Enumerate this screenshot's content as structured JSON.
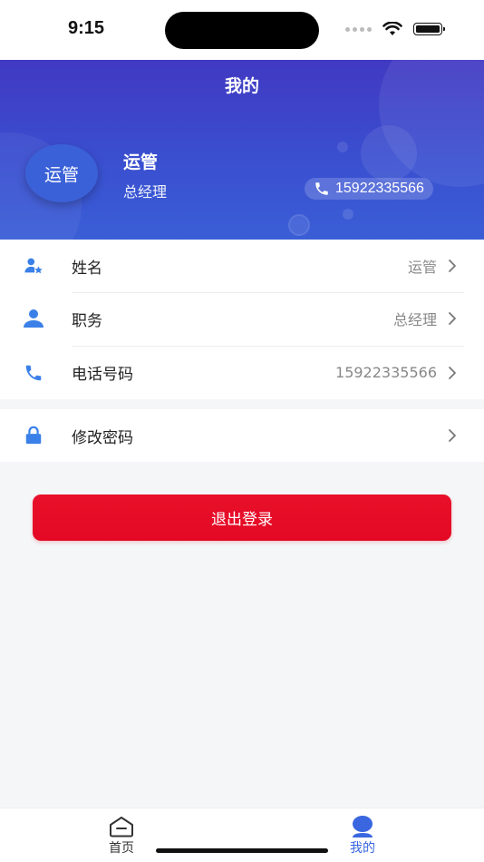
{
  "status_bar": {
    "time": "9:15"
  },
  "header": {
    "title": "我的",
    "avatar_text": "运管",
    "user_name": "运管",
    "user_role": "总经理",
    "phone": "15922335566"
  },
  "profile_items": [
    {
      "label": "姓名",
      "value": "运管",
      "icon": "user-tag-icon"
    },
    {
      "label": "职务",
      "value": "总经理",
      "icon": "user-icon"
    },
    {
      "label": "电话号码",
      "value": "15922335566",
      "icon": "phone-icon"
    }
  ],
  "security_items": [
    {
      "label": "修改密码",
      "icon": "lock-icon"
    }
  ],
  "logout_label": "退出登录",
  "tab_bar": {
    "tabs": [
      {
        "label": "首页",
        "icon": "home-icon",
        "active": false
      },
      {
        "label": "我的",
        "icon": "profile-icon",
        "active": true
      }
    ]
  },
  "colors": {
    "header_gradient_start": "#4139c2",
    "header_gradient_end": "#3a5ed6",
    "icon_blue": "#3a80e8",
    "logout_red": "#e8102a",
    "active_tab": "#3a66e0"
  }
}
